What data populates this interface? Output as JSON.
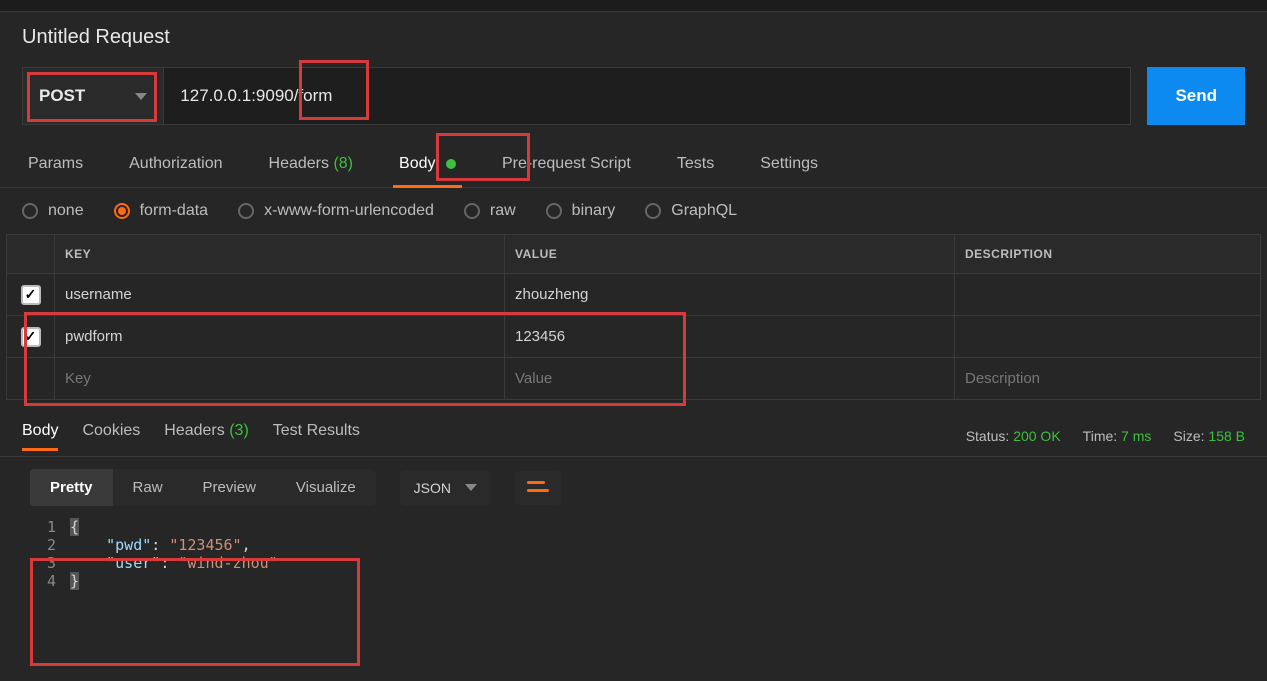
{
  "request": {
    "title": "Untitled Request",
    "method": "POST",
    "url": "127.0.0.1:9090/form",
    "send_label": "Send"
  },
  "req_tabs": {
    "params": "Params",
    "auth": "Authorization",
    "headers": "Headers",
    "headers_count": "(8)",
    "body": "Body",
    "prerequest": "Pre-request Script",
    "tests": "Tests",
    "settings": "Settings"
  },
  "body_types": {
    "none": "none",
    "formdata": "form-data",
    "urlencoded": "x-www-form-urlencoded",
    "raw": "raw",
    "binary": "binary",
    "graphql": "GraphQL"
  },
  "form_table": {
    "hdr_key": "KEY",
    "hdr_value": "VALUE",
    "hdr_desc": "DESCRIPTION",
    "rows": [
      {
        "key": "username",
        "value": "zhouzheng"
      },
      {
        "key": "pwdform",
        "value": "123456"
      }
    ],
    "ph_key": "Key",
    "ph_value": "Value",
    "ph_desc": "Description"
  },
  "resp_tabs": {
    "body": "Body",
    "cookies": "Cookies",
    "headers": "Headers",
    "headers_count": "(3)",
    "test_results": "Test Results"
  },
  "resp_meta": {
    "status_label": "Status:",
    "status_value": "200 OK",
    "time_label": "Time:",
    "time_value": "7 ms",
    "size_label": "Size:",
    "size_value": "158 B"
  },
  "view_tabs": {
    "pretty": "Pretty",
    "raw": "Raw",
    "preview": "Preview",
    "visualize": "Visualize"
  },
  "lang_select": "JSON",
  "response_json": {
    "line1_num": "1",
    "line1_brace": "{",
    "line2_num": "2",
    "line2_key": "\"pwd\"",
    "line2_val": "\"123456\"",
    "line3_num": "3",
    "line3_key": "\"user\"",
    "line3_val": "\"wind-zhou\"",
    "line4_num": "4",
    "line4_brace": "}"
  }
}
